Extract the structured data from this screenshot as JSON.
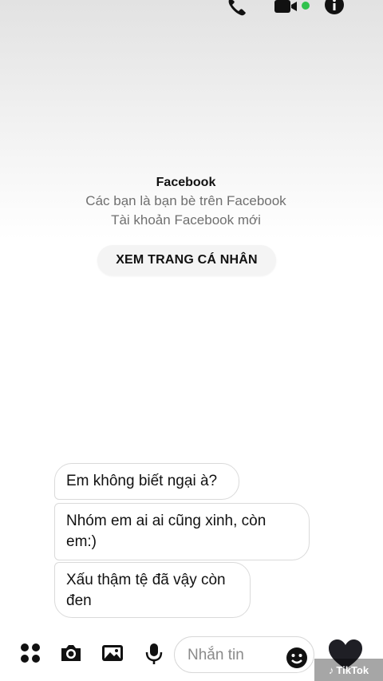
{
  "header": {
    "call_icon": "phone-icon",
    "video_icon": "video-camera-icon",
    "info_icon": "info-icon",
    "online_color": "#31c24d"
  },
  "profile": {
    "name": "Facebook",
    "line1": "Các bạn là bạn bè trên Facebook",
    "line2": "Tài khoản Facebook mới",
    "view_button": "XEM TRANG CÁ NHÂN"
  },
  "messages": [
    {
      "text": "Em không biết ngại à?"
    },
    {
      "text": "Nhóm em ai ai cũng xinh, còn em:)"
    },
    {
      "text": "Xấu thậm tệ đã vậy còn đen"
    }
  ],
  "composer": {
    "placeholder": "Nhắn tin",
    "icons": [
      "more-apps-icon",
      "camera-icon",
      "gallery-icon",
      "microphone-icon",
      "emoji-icon",
      "heart-icon"
    ]
  },
  "watermark": {
    "text": "TikTok"
  }
}
